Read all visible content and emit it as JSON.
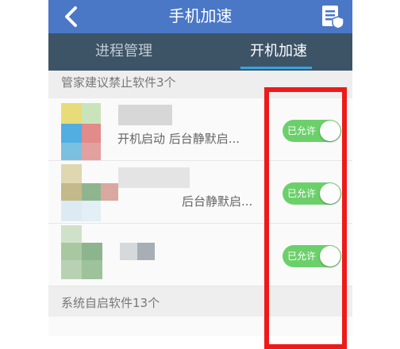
{
  "header": {
    "title": "手机加速",
    "back_icon": "chevron-left-icon",
    "right_icon": "clipboard-shield-icon"
  },
  "tabs": [
    {
      "label": "进程管理",
      "active": false
    },
    {
      "label": "开机加速",
      "active": true
    }
  ],
  "sections": {
    "suggest": "管家建议禁止软件3个",
    "system": "系统自启软件13个"
  },
  "apps": [
    {
      "description": "开机启动 后台静默启...",
      "toggle": "已允许"
    },
    {
      "description": "后台静默启...",
      "toggle": "已允许"
    },
    {
      "description": "",
      "toggle": "已允许"
    }
  ],
  "colors": {
    "header": "#4a77c6",
    "tabbar": "#3d5467",
    "toggle_on": "#6cd06a",
    "highlight": "#ee1a1a"
  }
}
